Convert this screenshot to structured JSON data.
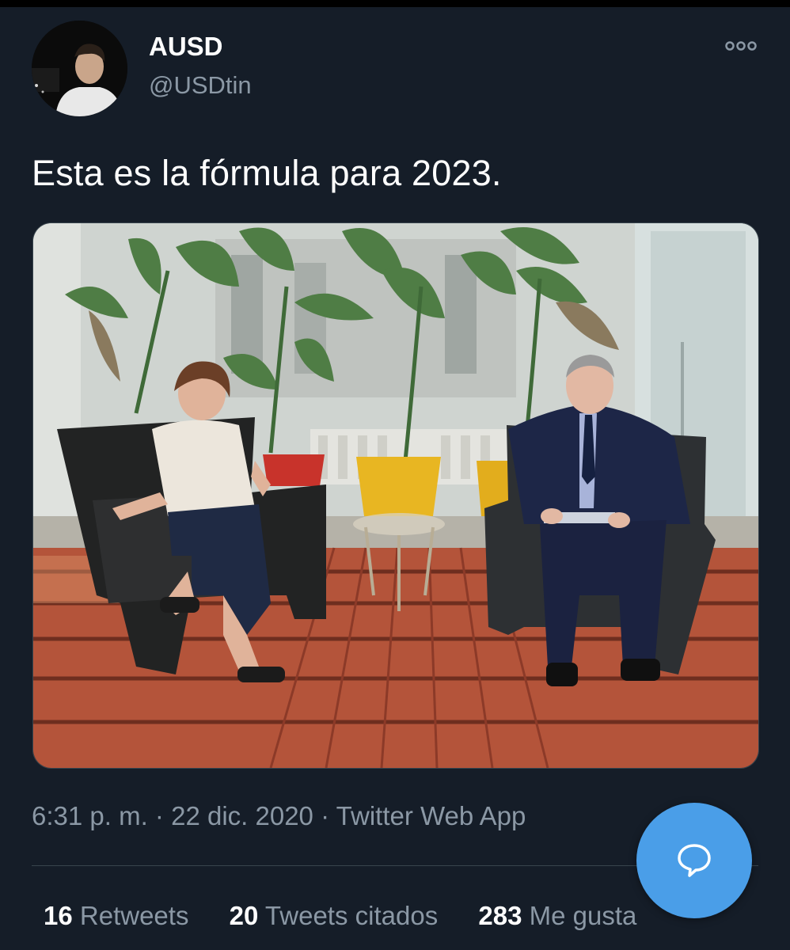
{
  "tweet": {
    "author_name": "AUSD",
    "author_handle": "@USDtin",
    "text": "Esta es la fórmula para 2023.",
    "time": "6:31 p. m.",
    "separator": "·",
    "date": "22 dic. 2020",
    "source": "Twitter Web App"
  },
  "stats": {
    "retweets_count": "16",
    "retweets_label": "Retweets",
    "quotes_count": "20",
    "quotes_label": "Tweets citados",
    "likes_count": "283",
    "likes_label": "Me gusta"
  },
  "icons": {
    "more": "more-options-icon",
    "compose": "speech-bubble-icon"
  },
  "colors": {
    "background": "#151d28",
    "secondary_text": "#8b98a5",
    "accent": "#4a9ee8"
  }
}
